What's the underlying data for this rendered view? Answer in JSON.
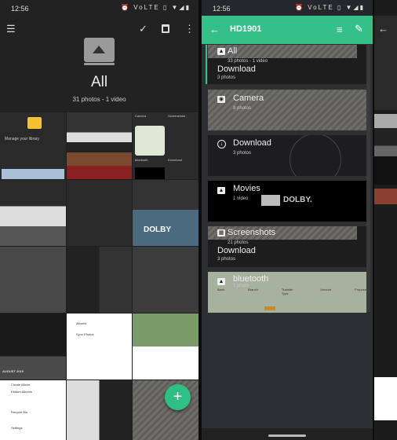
{
  "left": {
    "status": {
      "time": "12:56",
      "icons": "⏰ VoLTE ▯ ▼◢▮"
    },
    "toolbar": {
      "menu_icon": "hamburger-icon",
      "check_icon": "check-icon",
      "calendar_icon": "calendar-icon",
      "more_icon": "more-vert-icon"
    },
    "header": {
      "title": "All",
      "subtitle": "31 photos - 1 video",
      "icon": "album-icon"
    },
    "grid_text": {
      "manage": "Manage your library",
      "august": "AUGUST 2019",
      "albums": "Albums",
      "sync": "Sync Photos",
      "camera": "Camera",
      "screenshots": "Screenshots",
      "download": "Download",
      "bluetooth": "bluetooth",
      "create_album": "Create Album",
      "hidden_albums": "Hidden Albums",
      "recycle_bin": "Recycle Bin",
      "settings": "Settings",
      "dolby": "DOLBY"
    },
    "fab": {
      "label": "+",
      "color": "#2fbf85"
    }
  },
  "right": {
    "status": {
      "time": "12:56",
      "icons": "⏰ VoLTE ▯ ▼◢▮"
    },
    "toolbar": {
      "title": "HD1901",
      "color": "#35c088",
      "back_icon": "arrow-left-icon",
      "sort_icon": "sort-icon",
      "edit_icon": "pencil-icon"
    },
    "albums": [
      {
        "title": "All",
        "sub": "33 photos - 1 video"
      },
      {
        "title": "Download",
        "sub": "3 photos"
      },
      {
        "title": "Camera",
        "sub": "8 photos"
      },
      {
        "title": "Download",
        "sub": "3 photos"
      },
      {
        "title": "Movies",
        "sub": "1 video",
        "badge": "DOLBY."
      },
      {
        "title": "Screenshots",
        "sub": "21 photos"
      },
      {
        "title": "Download",
        "sub": "3 photos"
      },
      {
        "title": "bluetooth",
        "sub": "1 photo"
      }
    ],
    "bluetooth_table": [
      "Bank",
      "Branch",
      "Transfer Type",
      "Amount",
      "Purpose"
    ]
  },
  "strip": {
    "back_icon": "arrow-left-icon"
  }
}
